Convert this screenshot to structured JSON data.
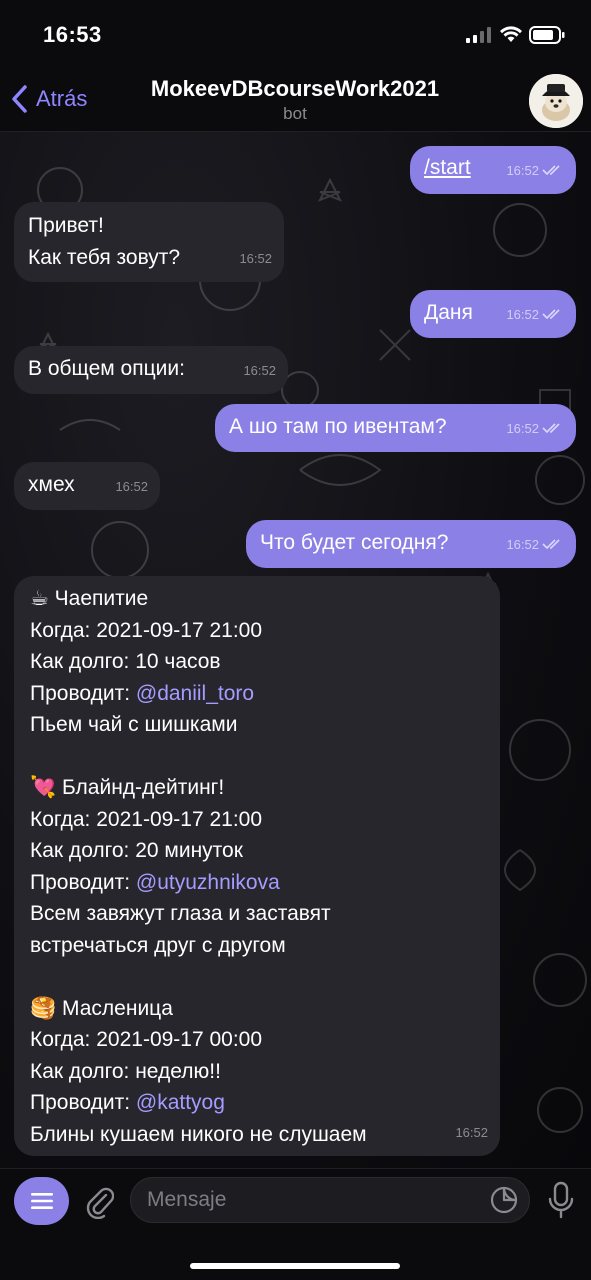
{
  "status_bar": {
    "time": "16:53"
  },
  "header": {
    "back_label": "Atrás",
    "title": "MokeevDBcourseWork2021",
    "subtitle": "bot"
  },
  "messages": [
    {
      "direction": "out",
      "text": "/start",
      "time": "16:52",
      "read": true
    },
    {
      "direction": "in",
      "text": "Привет!\nКак тебя зовут?",
      "time": "16:52"
    },
    {
      "direction": "out",
      "text": "Даня",
      "time": "16:52",
      "read": true
    },
    {
      "direction": "in",
      "text": "В общем опции:",
      "time": "16:52"
    },
    {
      "direction": "out",
      "text": "А шо там по ивентам?",
      "time": "16:52",
      "read": true
    },
    {
      "direction": "in",
      "text": "хмех",
      "time": "16:52"
    },
    {
      "direction": "out",
      "text": "Что будет сегодня?",
      "time": "16:52",
      "read": true
    }
  ],
  "events_message": {
    "time": "16:52",
    "events": [
      {
        "emoji": "☕",
        "title": "Чаепитие",
        "when": "Когда: 2021-09-17 21:00",
        "duration": "Как долго: 10 часов",
        "host_prefix": "Проводит: ",
        "host": "@daniil_toro",
        "description": "Пьем чай с шишками"
      },
      {
        "emoji": "💘",
        "title": "Блайнд-дейтинг!",
        "when": "Когда: 2021-09-17 21:00",
        "duration": "Как долго: 20 минуток",
        "host_prefix": "Проводит: ",
        "host": "@utyuzhnikova",
        "description": "Всем завяжут глаза и заставят\nвстречаться друг с другом"
      },
      {
        "emoji": "🥞",
        "title": "Масленица",
        "when": "Когда: 2021-09-17 00:00",
        "duration": "Как долго: неделю!!",
        "host_prefix": "Проводит: ",
        "host": "@kattyog",
        "description": "Блины кушаем никого не слушаем"
      }
    ]
  },
  "input": {
    "placeholder": "Mensaje"
  },
  "colors": {
    "accent": "#8b80e6",
    "incoming_bubble": "#26262c",
    "link": "#a59cff",
    "background": "#0b0b0e"
  },
  "icons": {
    "back": "chevron-left-icon",
    "menu": "menu-icon",
    "attach": "paperclip-icon",
    "sticker": "sticker-icon",
    "mic": "microphone-icon",
    "read": "double-check-icon"
  }
}
